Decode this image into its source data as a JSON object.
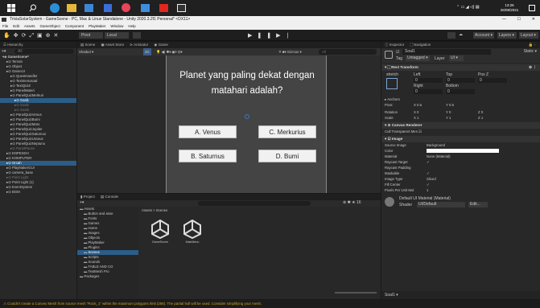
{
  "window_title": "TriviaSolarSystem - GameScene - PC, Mac & Linux Standalone - Unity 2020.3.2f1 Personal* <DX11>",
  "menu": [
    "File",
    "Edit",
    "Assets",
    "GameObject",
    "Component",
    "PlayMaker",
    "Window",
    "Help"
  ],
  "clock": {
    "time": "13:26",
    "date": "26/08/2021"
  },
  "toolbar": {
    "pivot": "Pivot",
    "local": "Local",
    "account": "Account",
    "layers": "Layers",
    "layout": "Layout"
  },
  "hierarchy": {
    "tab": "Hierarchy",
    "search_placeholder": "All",
    "items": [
      {
        "label": "GameScene*",
        "indent": 0,
        "bold": true
      },
      {
        "label": "Terrain",
        "indent": 1
      },
      {
        "label": "Object",
        "indent": 1
      },
      {
        "label": "GameUI",
        "indent": 1
      },
      {
        "label": "QuestHandler",
        "indent": 2
      },
      {
        "label": "Textmenusoal",
        "indent": 2
      },
      {
        "label": "TextQUIZ",
        "indent": 2
      },
      {
        "label": "PanelMateri",
        "indent": 2
      },
      {
        "label": "PanelQuizMerkuri",
        "indent": 2
      },
      {
        "label": "Soal1",
        "indent": 3,
        "selected": true
      },
      {
        "label": "Soal2",
        "indent": 3,
        "muted": true
      },
      {
        "label": "Soal3",
        "indent": 3,
        "muted": true
      },
      {
        "label": "PanelQuizVenus",
        "indent": 2
      },
      {
        "label": "PanelQuizBumi",
        "indent": 2
      },
      {
        "label": "PanelQuizMars",
        "indent": 2
      },
      {
        "label": "PanelQuizJupiter",
        "indent": 2
      },
      {
        "label": "PanelQuizSaturnus",
        "indent": 2
      },
      {
        "label": "PanelQuizUranus",
        "indent": 2
      },
      {
        "label": "PanelQuizNeptunu",
        "indent": 2
      },
      {
        "label": "PanelPause",
        "indent": 2,
        "muted": true
      },
      {
        "label": "ENPESDH",
        "indent": 1
      },
      {
        "label": "KOMPUTER",
        "indent": 1
      },
      {
        "label": "Orcah",
        "indent": 1,
        "selected": true
      },
      {
        "label": "PlayMakerGUI",
        "indent": 1
      },
      {
        "label": "camera_base",
        "indent": 1
      },
      {
        "label": "Point Light",
        "indent": 1,
        "muted": true
      },
      {
        "label": "Point Light (1)",
        "indent": 1
      },
      {
        "label": "EventSystem",
        "indent": 1
      },
      {
        "label": "BGM",
        "indent": 1
      }
    ]
  },
  "scene_tabs": {
    "scene": "Scene",
    "asset_store": "Asset Store",
    "animator": "Animator",
    "game": "Game",
    "shading": "Shaded",
    "mode": "2D",
    "gizmos": "Gizmos",
    "search": "All"
  },
  "quiz": {
    "question": "Planet yang paling dekat dengan matahari adalah?",
    "answers": [
      "A. Venus",
      "C. Merkurius",
      "B. Saturnus",
      "D. Bumi"
    ]
  },
  "project": {
    "tab_project": "Project",
    "tab_console": "Console",
    "breadcrumb": "Assets > Scenes",
    "search": "",
    "tree": [
      "Assets",
      "Button and asse",
      "Fonts",
      "Games",
      "Home",
      "Images",
      "Objects",
      "PlayMaker",
      "Plugins",
      "Scenes",
      "Scripts",
      "Sounds",
      "TABLE AND CO",
      "TextMesh Pro",
      "Packages"
    ],
    "files": [
      {
        "name": "GameScene"
      },
      {
        "name": "MainMenu"
      }
    ],
    "count": "16"
  },
  "inspector": {
    "tab_inspector": "Inspector",
    "tab_navigation": "Navigation",
    "object_name": "Soal1",
    "static": "Static",
    "tag_label": "Tag",
    "tag": "Untagged",
    "layer_label": "Layer",
    "layer": "UI",
    "rect_transform": "Rect Transform",
    "stretch": "stretch",
    "rt_labels": [
      "Left",
      "Top",
      "Pos Z",
      "Right",
      "Bottom"
    ],
    "rt_values": [
      "0",
      "0",
      "0",
      "0",
      "0"
    ],
    "anchors": "Anchors",
    "pivot_label": "Pivot",
    "pivot_x": "X 0.5",
    "pivot_y": "Y 0.5",
    "rotation": "Rotation",
    "rot": [
      "X 0",
      "Y 0",
      "Z 0"
    ],
    "scale": "Scale",
    "scl": [
      "X 1",
      "Y 1",
      "Z 1"
    ],
    "canvas_renderer": "Canvas Renderer",
    "cull": "Cull Transparent Mes",
    "image": "Image",
    "image_rows": [
      {
        "k": "Source Image",
        "v": "Background"
      },
      {
        "k": "Color",
        "v": ""
      },
      {
        "k": "Material",
        "v": "None (Material)"
      },
      {
        "k": "Raycast Target",
        "v": "✓"
      },
      {
        "k": "Raycast Padding",
        "v": ""
      },
      {
        "k": "Maskable",
        "v": "✓"
      },
      {
        "k": "Image Type",
        "v": "Sliced"
      },
      {
        "k": "Fill Center",
        "v": "✓"
      },
      {
        "k": "Pixels Per Unit Mul",
        "v": "1"
      }
    ],
    "material_name": "Default UI Material (Material)",
    "shader_label": "Shader",
    "shader": "UI/Default",
    "edit": "Edit...",
    "footer": "Soal1"
  },
  "status": "Couldn't create a Convex Mesh from source mesh \"Rock_1\" within the maximum polygons limit (256). The partial hull will be used. Consider simplifying your mesh.",
  "colors": {
    "accent": "#3a79c4",
    "warning": "#e2b32c",
    "selection": "#2c5d87"
  }
}
